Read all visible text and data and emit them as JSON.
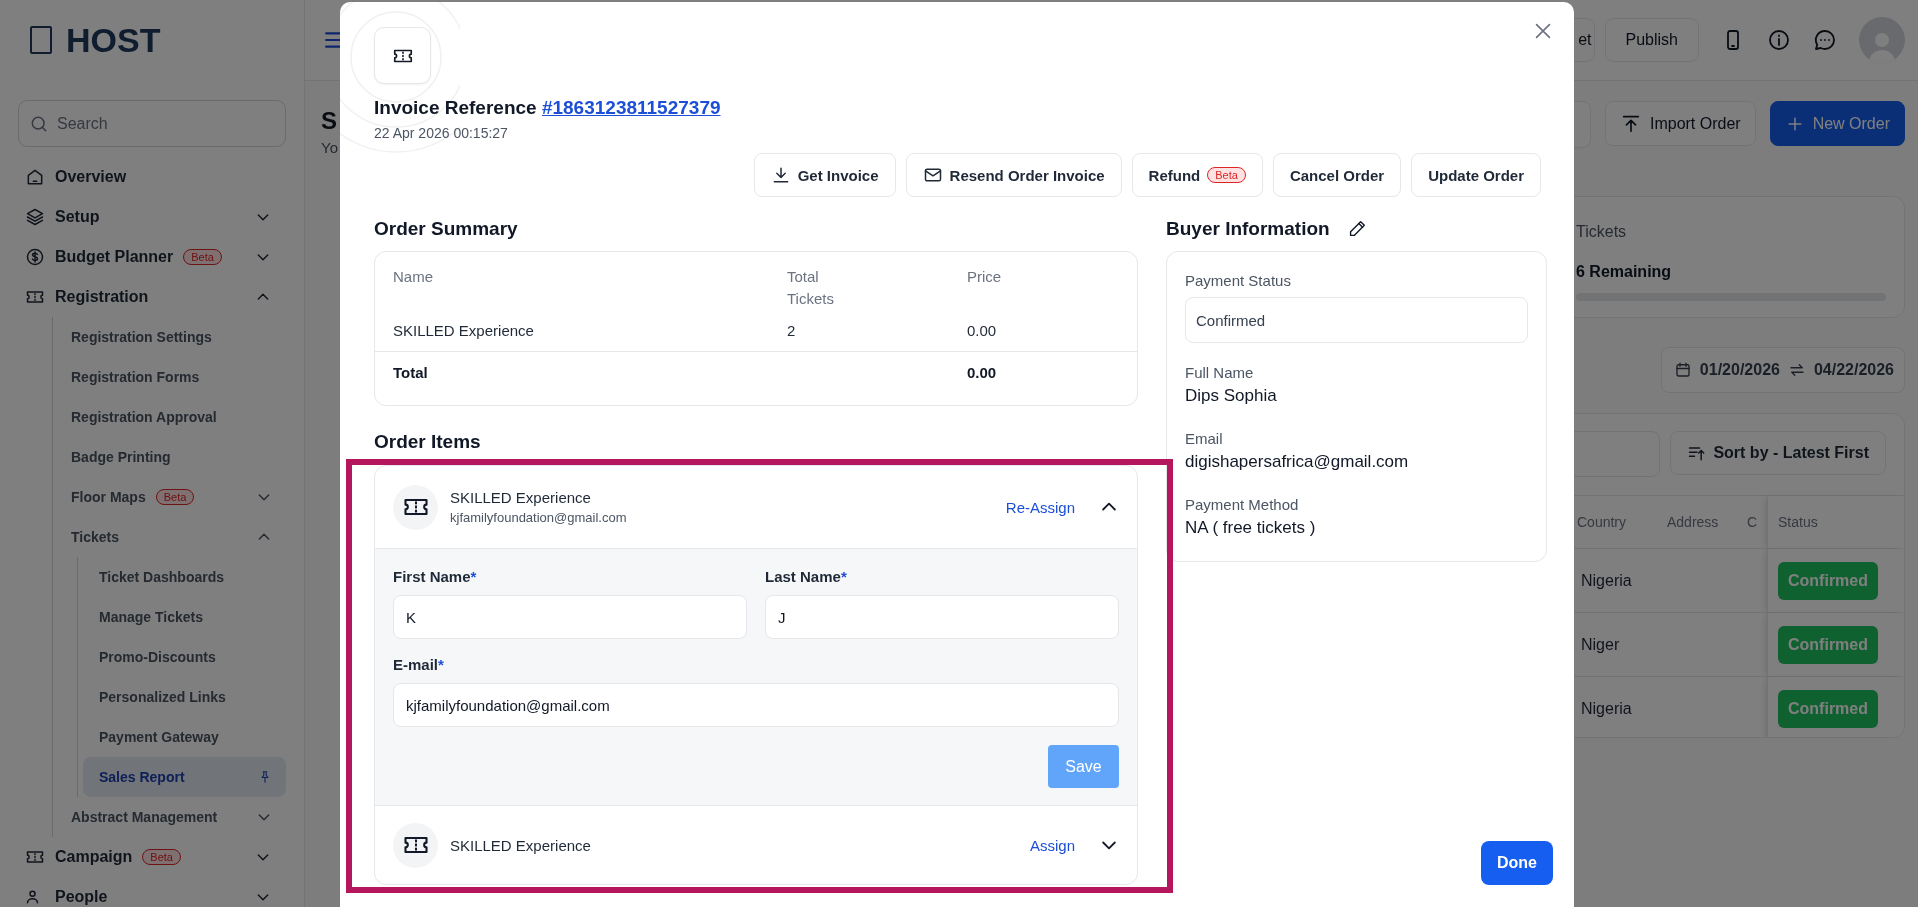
{
  "sidebar": {
    "logo": "HOST",
    "search": {
      "placeholder": "Search"
    },
    "items": [
      {
        "label": "Overview",
        "kind": "link",
        "selected": false
      },
      {
        "label": "Setup",
        "kind": "group",
        "expanded": false,
        "selected": false
      },
      {
        "label": "Budget Planner",
        "badge": "Beta",
        "kind": "group",
        "expanded": false,
        "selected": false
      },
      {
        "label": "Registration",
        "kind": "group",
        "expanded": true,
        "selected": false,
        "children": [
          {
            "label": "Registration Settings",
            "kind": "link",
            "selected": false
          },
          {
            "label": "Registration Forms",
            "kind": "link",
            "selected": false
          },
          {
            "label": "Registration Approval",
            "kind": "link",
            "selected": false
          },
          {
            "label": "Badge Printing",
            "kind": "link",
            "selected": false
          },
          {
            "label": "Floor Maps",
            "badge": "Beta",
            "kind": "group",
            "expanded": false,
            "selected": false
          },
          {
            "label": "Tickets",
            "kind": "group",
            "expanded": true,
            "selected": false,
            "children": [
              {
                "label": "Ticket Dashboards",
                "kind": "link",
                "selected": false
              },
              {
                "label": "Manage Tickets",
                "kind": "link",
                "selected": false
              },
              {
                "label": "Promo-Discounts",
                "kind": "link",
                "selected": false
              },
              {
                "label": "Personalized Links",
                "kind": "link",
                "selected": false
              },
              {
                "label": "Payment Gateway",
                "kind": "link",
                "selected": false
              },
              {
                "label": "Sales Report",
                "kind": "link",
                "selected": true
              }
            ]
          },
          {
            "label": "Abstract Management",
            "kind": "group",
            "expanded": false,
            "selected": false
          }
        ]
      },
      {
        "label": "Campaign",
        "badge": "Beta",
        "kind": "group",
        "expanded": false,
        "selected": false
      },
      {
        "label": "People",
        "kind": "group",
        "expanded": false,
        "selected": false
      }
    ]
  },
  "topbar": {
    "buttons": [
      "et",
      "Publish"
    ]
  },
  "page": {
    "title": "S",
    "subtitle": "Yo",
    "actions": [
      {
        "label": "Import Order",
        "kind": "secondary"
      },
      {
        "label": "New Order",
        "kind": "primary"
      }
    ],
    "tickets_card": {
      "title": "Tickets",
      "remaining": "6 Remaining"
    },
    "date_range": {
      "start": "01/20/2026",
      "end": "04/22/2026"
    },
    "sort": "Sort by - Latest First",
    "table": {
      "columns": [
        "Country",
        "Address",
        "C",
        "Status"
      ],
      "rows": [
        {
          "country": "Nigeria",
          "status": "Confirmed"
        },
        {
          "country": "Niger",
          "status": "Confirmed"
        },
        {
          "country": "Nigeria",
          "status": "Confirmed"
        }
      ]
    }
  },
  "modal": {
    "title": "Invoice Reference",
    "reference": "#1863123811527379",
    "date": "22 Apr 2026 00:15:27",
    "actions": [
      {
        "label": "Get Invoice",
        "kind": "download"
      },
      {
        "label": "Resend Order Invoice",
        "kind": "mail"
      },
      {
        "label": "Refund",
        "badge": "Beta",
        "kind": "plain"
      },
      {
        "label": "Cancel Order",
        "kind": "plain"
      },
      {
        "label": "Update Order",
        "kind": "plain"
      }
    ],
    "order_summary": {
      "title": "Order Summary",
      "columns": [
        "Name",
        "Total Tickets",
        "Price"
      ],
      "rows": [
        [
          "SKILLED Experience",
          "2",
          "0.00"
        ]
      ],
      "total": {
        "label": "Total",
        "value": "0.00"
      }
    },
    "order_items": {
      "title": "Order Items",
      "items": [
        {
          "name": "SKILLED Experience",
          "email": "kjfamilyfoundation@gmail.com",
          "action": "Re-Assign",
          "expanded": true,
          "fields": [
            {
              "label": "First Name",
              "mark": "*",
              "value": "K"
            },
            {
              "label": "Last Name",
              "mark": "*",
              "value": "J"
            },
            {
              "label": "E-mail",
              "mark": "*",
              "value": "kjfamilyfoundation@gmail.com"
            }
          ],
          "save": {
            "label": "Save",
            "disabled": true
          }
        },
        {
          "name": "SKILLED Experience",
          "action": "Assign",
          "expanded": false
        }
      ]
    },
    "buyer": {
      "title": "Buyer Information",
      "payment_status": {
        "label": "Payment Status",
        "value": "Confirmed"
      },
      "fields": [
        {
          "label": "Full Name",
          "value": "Dips Sophia"
        },
        {
          "label": "Email",
          "value": "digishapersafrica@gmail.com"
        },
        {
          "label": "Payment Method",
          "value": "NA ( free tickets )"
        }
      ]
    },
    "done": "Done"
  }
}
